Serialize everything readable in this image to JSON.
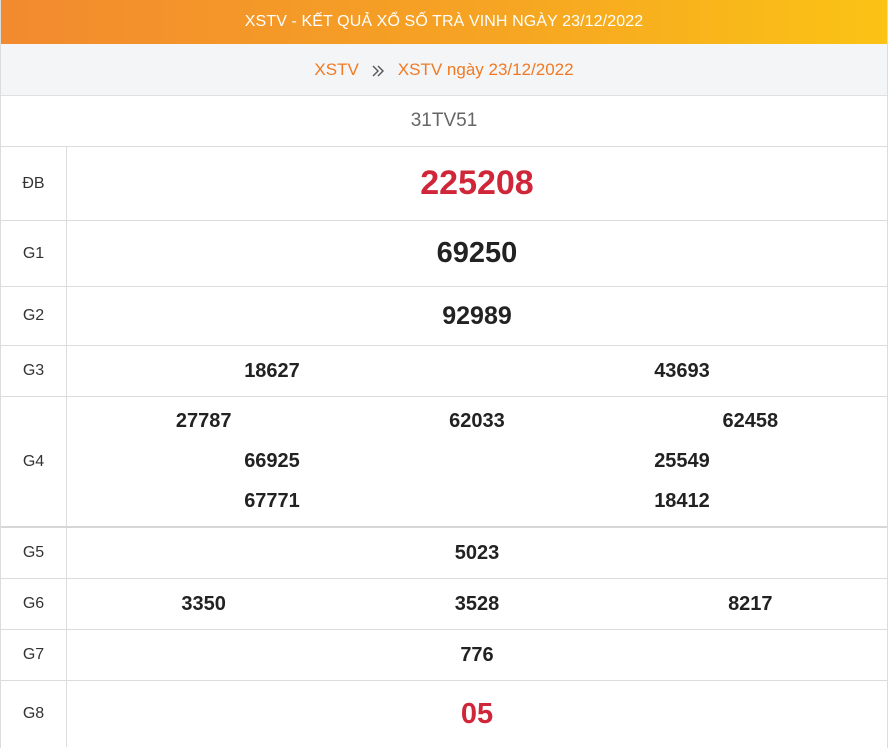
{
  "header": {
    "title": "XSTV - KẾT QUẢ XỔ SỐ TRÀ VINH NGÀY 23/12/2022"
  },
  "breadcrumb": {
    "home": "XSTV",
    "separator_icon": "double-chevron-right-icon",
    "current": "XSTV ngày 23/12/2022"
  },
  "ticket_code": "31TV51",
  "colors": {
    "accent_orange": "#f07a24",
    "header_gradient_start": "#f28a2f",
    "header_gradient_end": "#fbc315",
    "jackpot_red": "#d0263a"
  },
  "prizes": {
    "db": {
      "label": "ĐB",
      "numbers": [
        "225208"
      ]
    },
    "g1": {
      "label": "G1",
      "numbers": [
        "69250"
      ]
    },
    "g2": {
      "label": "G2",
      "numbers": [
        "92989"
      ]
    },
    "g3": {
      "label": "G3",
      "numbers": [
        "18627",
        "43693"
      ]
    },
    "g4": {
      "label": "G4",
      "numbers": [
        "27787",
        "62033",
        "62458",
        "66925",
        "25549",
        "67771",
        "18412"
      ]
    },
    "g5": {
      "label": "G5",
      "numbers": [
        "5023"
      ]
    },
    "g6": {
      "label": "G6",
      "numbers": [
        "3350",
        "3528",
        "8217"
      ]
    },
    "g7": {
      "label": "G7",
      "numbers": [
        "776"
      ]
    },
    "g8": {
      "label": "G8",
      "numbers": [
        "05"
      ]
    }
  }
}
